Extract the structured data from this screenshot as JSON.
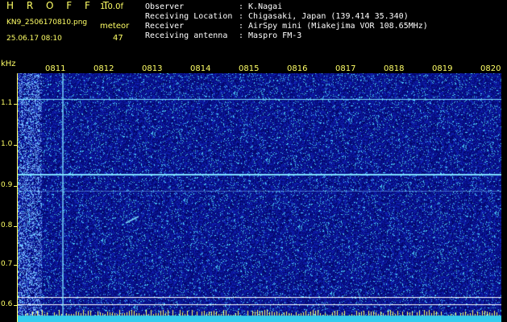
{
  "header": {
    "app_title": "H R O F F T",
    "app_version": "1.0.0f",
    "file_name": "KN9_2506170810.png",
    "meteor_label": "meteor",
    "timestamp": "25.06.17 08:10",
    "meteor_count": "47",
    "info": [
      {
        "label": "Observer",
        "value": ": K.Nagai"
      },
      {
        "label": "Receiving Location",
        "value": ": Chigasaki, Japan (139.414 35.340)"
      },
      {
        "label": "Receiver",
        "value": ": AirSpy mini (Miakejima VOR 108.65MHz)"
      },
      {
        "label": "Receiving antenna",
        "value": ": Maspro FM-3"
      }
    ]
  },
  "axis": {
    "unit": "kHz",
    "y_labels": [
      "1.1",
      "1.0",
      "0.9",
      "0.8",
      "0.7",
      "0.6"
    ],
    "time_labels": [
      "0811",
      "0812",
      "0813",
      "0814",
      "0815",
      "0816",
      "0817",
      "0818",
      "0819",
      "0820"
    ]
  },
  "colors": {
    "background": "#000000",
    "label_yellow": "#ffff66",
    "noise_blue": "#1a1aa8",
    "trace_cyan": "#7fe0ff"
  }
}
